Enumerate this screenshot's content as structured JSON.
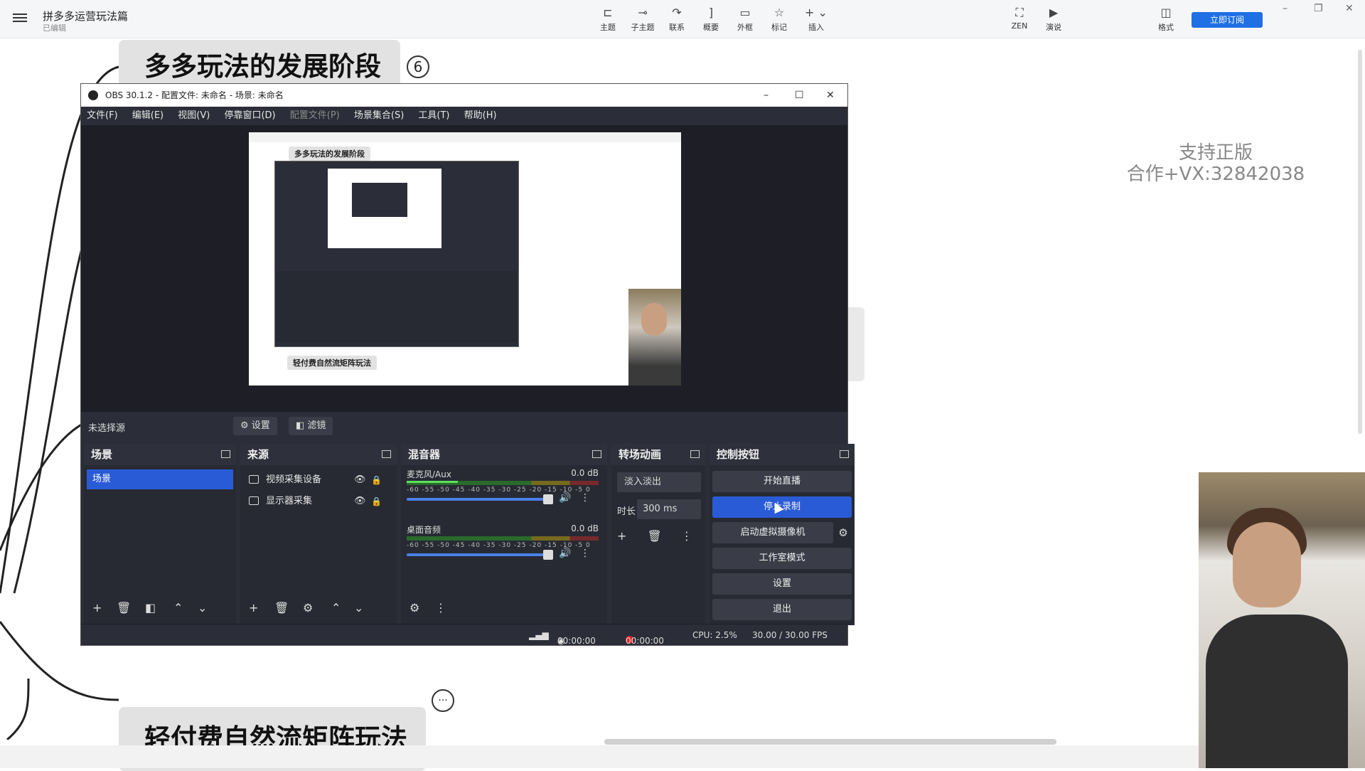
{
  "app": {
    "doc_title": "拼多多运营玩法篇",
    "doc_status": "已编辑",
    "toolbar": [
      {
        "label": "主题",
        "icon": "topic-icon"
      },
      {
        "label": "子主题",
        "icon": "subtopic-icon"
      },
      {
        "label": "联系",
        "icon": "relation-icon"
      },
      {
        "label": "概要",
        "icon": "summary-icon"
      },
      {
        "label": "外框",
        "icon": "boundary-icon"
      },
      {
        "label": "标记",
        "icon": "star-icon"
      },
      {
        "label": "插入",
        "icon": "plus-icon"
      }
    ],
    "zen_label": "ZEN",
    "present_label": "演说",
    "format_label": "格式",
    "subscribe_label": "立即订阅"
  },
  "mindmap": {
    "node1_text": "多多玩法的发展阶段",
    "node1_badge": "6",
    "node2_text": "轻付费自然流矩阵玩法",
    "node2_badge": "···",
    "watermark_line1": "支持正版",
    "watermark_line2": "合作+VX:32842038"
  },
  "obs": {
    "title": "OBS 30.1.2 - 配置文件: 未命名 - 场景: 未命名",
    "menu": [
      "文件(F)",
      "编辑(E)",
      "视图(V)",
      "停靠窗口(D)",
      "配置文件(P)",
      "场景集合(S)",
      "工具(T)",
      "帮助(H)"
    ],
    "preview": {
      "node1": "多多玩法的发展阶段",
      "node2": "轻付费自然流矩阵玩法"
    },
    "source_bar": {
      "no_source": "未选择源",
      "settings": "设置",
      "filters": "滤镜"
    },
    "docks": {
      "scenes": {
        "title": "场景",
        "items": [
          "场景"
        ]
      },
      "sources": {
        "title": "来源",
        "items": [
          "视频采集设备",
          "显示器采集"
        ]
      },
      "mixer": {
        "title": "混音器",
        "ticks": "-60 -55 -50 -45 -40 -35 -30 -25 -20 -15 -10 -5 0",
        "channels": [
          {
            "name": "麦克风/Aux",
            "db": "0.0 dB"
          },
          {
            "name": "桌面音频",
            "db": "0.0 dB"
          }
        ]
      },
      "transitions": {
        "title": "转场动画",
        "selected": "淡入淡出",
        "duration_label": "时长",
        "duration": "300 ms"
      },
      "controls": {
        "title": "控制按钮",
        "buttons": [
          "开始直播",
          "停止录制",
          "启动虚拟摄像机",
          "工作室模式",
          "设置",
          "退出"
        ]
      }
    },
    "status": {
      "stream_time": "00:00:00",
      "rec_time": "00:00:00",
      "cpu": "CPU: 2.5%",
      "fps": "30.00 / 30.00 FPS"
    }
  }
}
